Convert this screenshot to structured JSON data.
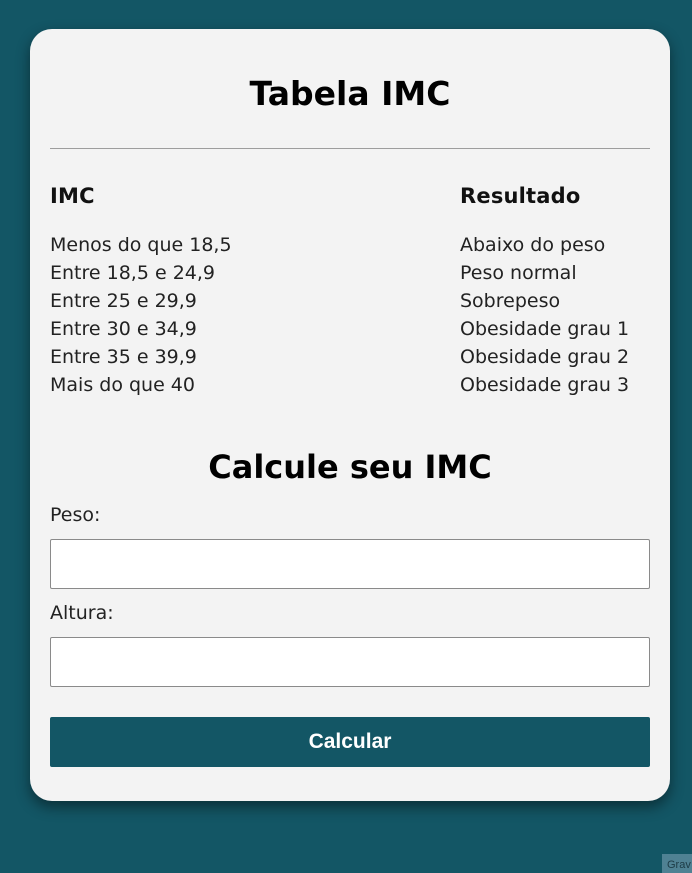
{
  "page": {
    "background_color": "#135665",
    "card_color": "#f3f3f3",
    "accent_color": "#135665"
  },
  "table_section": {
    "title": "Tabela IMC",
    "header_imc": "IMC",
    "header_result": "Resultado",
    "rows": [
      {
        "imc": "Menos do que 18,5",
        "result": "Abaixo do peso"
      },
      {
        "imc": "Entre 18,5 e 24,9",
        "result": "Peso normal"
      },
      {
        "imc": "Entre 25 e 29,9",
        "result": "Sobrepeso"
      },
      {
        "imc": "Entre 30 e 34,9",
        "result": "Obesidade grau 1"
      },
      {
        "imc": "Entre 35 e 39,9",
        "result": "Obesidade grau 2"
      },
      {
        "imc": "Mais do que 40",
        "result": "Obesidade grau 3"
      }
    ]
  },
  "form": {
    "title": "Calcule seu IMC",
    "peso_label": "Peso:",
    "peso_value": "",
    "altura_label": "Altura:",
    "altura_value": "",
    "submit_label": "Calcular"
  },
  "corner_tag": {
    "text": "Grav"
  }
}
